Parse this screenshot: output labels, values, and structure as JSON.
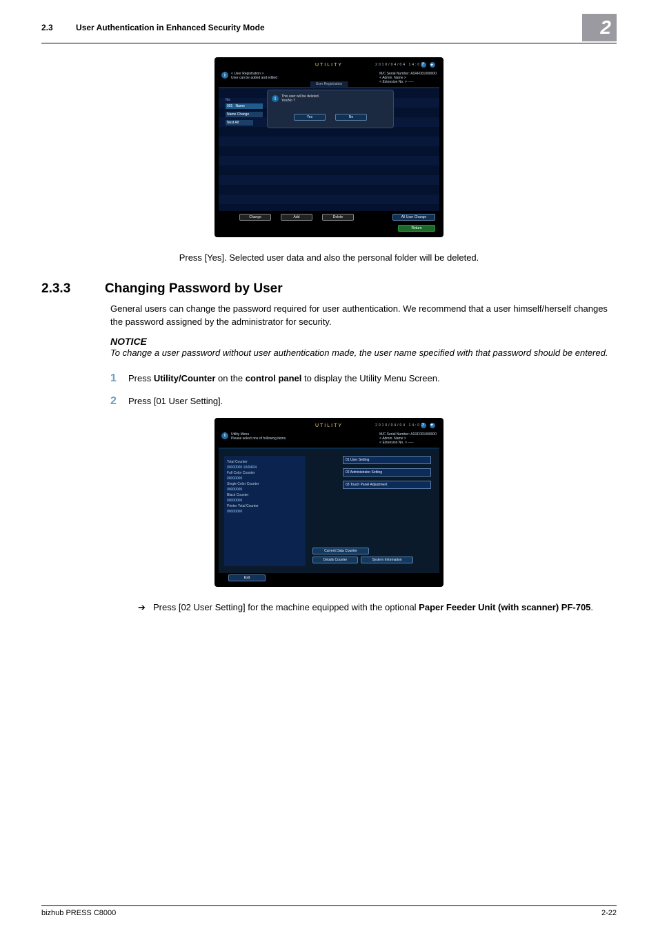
{
  "header": {
    "section_number": "2.3",
    "section_title": "User Authentication in Enhanced Security Mode",
    "chapter": "2"
  },
  "ss1": {
    "topbar_title": "UTILITY",
    "datetime": "2010/04/04 14:00",
    "info_line1": "< User Registration >",
    "info_line2": "User can be added and edited",
    "serial_label": "M/C Serial Number:",
    "serial_value": "A1RF001000000",
    "admin_label": "< Admin. Name >",
    "ext_label": "< Extension No. >  -----",
    "section_tab": "User Registration",
    "col_no": "No.",
    "row001": "001",
    "row_name": "Name",
    "tag_change": "Name Change",
    "tag_nextall": "Next All",
    "dialog_text": "This user will be deleted.\nYes/No ?",
    "btn_yes": "Yes",
    "btn_no": "No",
    "btn_change": "Change",
    "btn_add": "Add",
    "btn_delete": "Delete",
    "btn_allchange": "All User Change",
    "btn_return": "Return"
  },
  "caption1": "Press [Yes]. Selected user data and also the personal folder will be deleted.",
  "heading": {
    "number": "2.3.3",
    "title": "Changing Password by User"
  },
  "para1": "General users can change the password required for user authentication. We recommend that a user himself/herself changes the password assigned by the administrator for security.",
  "notice_label": "NOTICE",
  "notice_text": "To change a user password without user authentication made, the user name specified with that password should be entered.",
  "steps": {
    "s1a": "Press ",
    "s1b": "Utility/Counter",
    "s1c": " on the ",
    "s1d": "control panel",
    "s1e": " to display the Utility Menu Screen.",
    "s2": "Press [01 User Setting]."
  },
  "ss2": {
    "topbar_title": "UTILITY",
    "datetime": "2010/04/04 14:00",
    "info_line1": "Utility Menu",
    "info_line2": "Please select one of following items",
    "serial_label": "M/C Serial Number:",
    "serial_value": "A1RF001000000",
    "admin_label": "< Admin. Name >",
    "ext_label": "< Extension No. >  -----",
    "total_counter": "Total Counter",
    "total_val": "00000000   10/04/04",
    "full_color": "Full Color Counter",
    "full_val": "00000000",
    "single_color": "Single Color Counter",
    "single_val": "00000000",
    "black": "Black Counter",
    "black_val": "00000000",
    "printer_total": "Printer Total Counter",
    "printer_val": "00000000",
    "btn1": "01 User Setting",
    "btn2": "02 Administrator Setting",
    "btn3": "03 Touch Panel Adjustment",
    "bc1": "Current Data Counter",
    "bc2": "Details Counter",
    "bc3": "System Information",
    "exit": "Exit"
  },
  "substep_a": "Press [02 User Setting] for the machine equipped with the optional ",
  "substep_b": "Paper Feeder Unit (with scanner) PF-705",
  "substep_c": ".",
  "footer": {
    "left": "bizhub PRESS C8000",
    "right": "2-22"
  }
}
